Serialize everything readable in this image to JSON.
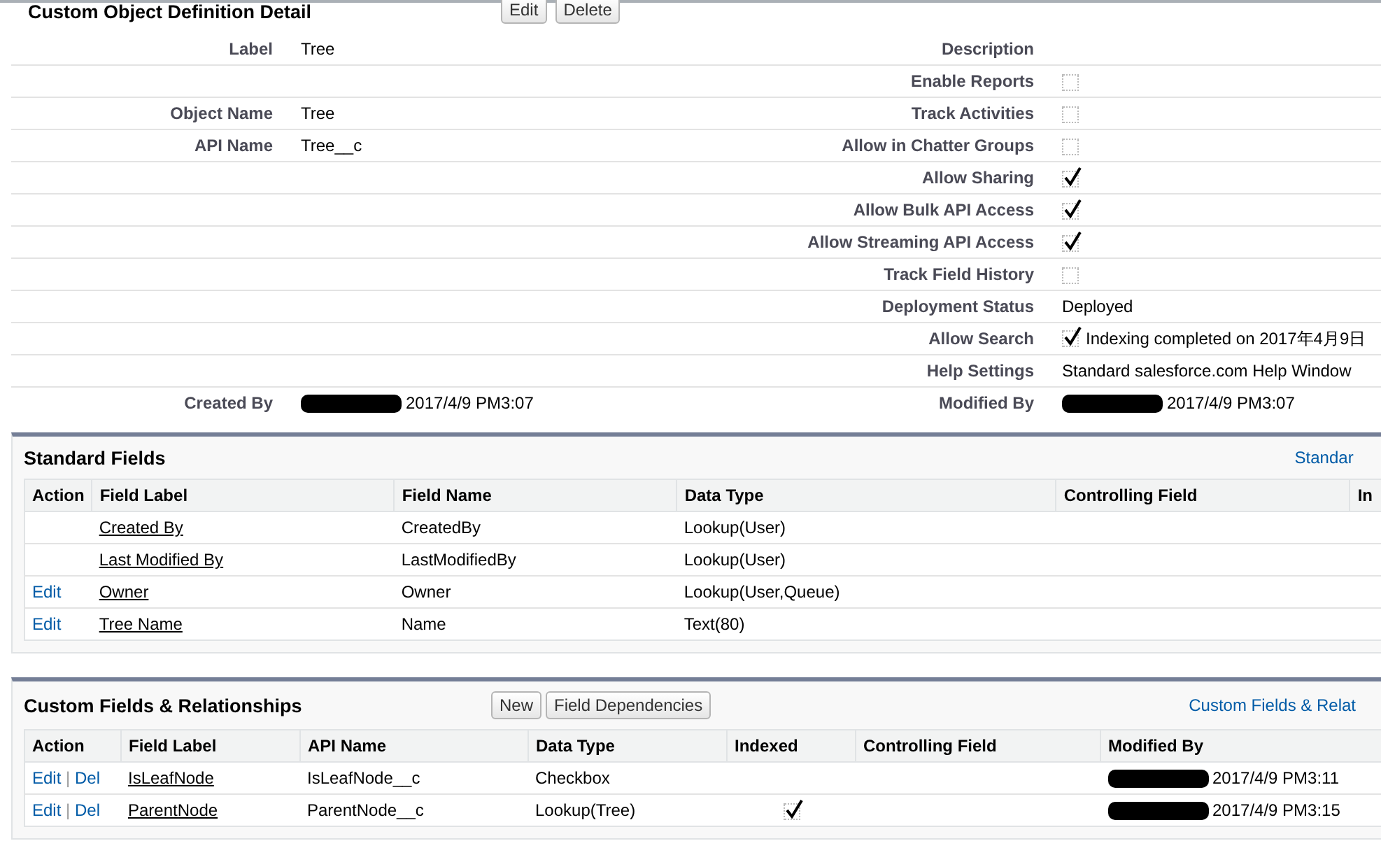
{
  "detail": {
    "title": "Custom Object Definition Detail",
    "buttons": [
      "Edit",
      "Delete"
    ],
    "rows": [
      {
        "left": {
          "label": "Label",
          "value": "Tree"
        },
        "right": {
          "kind": "text",
          "label": "Description"
        }
      },
      {
        "right": {
          "kind": "checkbox",
          "label": "Enable Reports",
          "checked": false
        }
      },
      {
        "left": {
          "label": "Object Name",
          "value": "Tree"
        },
        "right": {
          "kind": "checkbox",
          "label": "Track Activities",
          "checked": false
        }
      },
      {
        "left": {
          "label": "API Name",
          "value": "Tree__c"
        },
        "right": {
          "kind": "checkbox",
          "label": "Allow in Chatter Groups",
          "checked": false
        }
      },
      {
        "right": {
          "kind": "checkbox",
          "label": "Allow Sharing",
          "checked": true
        }
      },
      {
        "right": {
          "kind": "checkbox",
          "label": "Allow Bulk API Access",
          "checked": true
        }
      },
      {
        "right": {
          "kind": "checkbox",
          "label": "Allow Streaming API Access",
          "checked": true
        }
      },
      {
        "right": {
          "kind": "checkbox",
          "label": "Track Field History",
          "checked": false
        }
      },
      {
        "right": {
          "kind": "text",
          "label": "Deployment Status",
          "value": "Deployed"
        }
      },
      {
        "right": {
          "kind": "checkbox",
          "label": "Allow Search",
          "checked": true,
          "note": "Indexing completed on 2017年4月9日"
        }
      },
      {
        "right": {
          "kind": "text",
          "label": "Help Settings",
          "value": "Standard salesforce.com Help Window"
        }
      },
      {
        "left": {
          "label": "Created By",
          "value": "2017/4/9 PM3:07",
          "kind": "user"
        },
        "right": {
          "kind": "user",
          "label": "Modified By",
          "value": "2017/4/9 PM3:07"
        }
      }
    ]
  },
  "standard_fields": {
    "title": "Standard Fields",
    "help_link": "Standar",
    "columns": [
      "Action",
      "Field Label",
      "Field Name",
      "Data Type",
      "Controlling Field",
      "In"
    ],
    "rows": [
      {
        "actions": [],
        "field_label": "Created By",
        "field_name": "CreatedBy",
        "data_type": "Lookup(User)"
      },
      {
        "actions": [],
        "field_label": "Last Modified By",
        "field_name": "LastModifiedBy",
        "data_type": "Lookup(User)"
      },
      {
        "actions": [
          "Edit"
        ],
        "field_label": "Owner",
        "field_name": "Owner",
        "data_type": "Lookup(User,Queue)"
      },
      {
        "actions": [
          "Edit"
        ],
        "field_label": "Tree Name",
        "field_name": "Name",
        "data_type": "Text(80)"
      }
    ]
  },
  "custom_fields": {
    "title": "Custom Fields & Relationships",
    "buttons": [
      "New",
      "Field Dependencies"
    ],
    "action_separator": "|",
    "help_link": "Custom Fields & Relat",
    "columns": [
      "Action",
      "Field Label",
      "API Name",
      "Data Type",
      "Indexed",
      "Controlling Field",
      "Modified By"
    ],
    "rows": [
      {
        "actions": [
          "Edit",
          "Del"
        ],
        "field_label": "IsLeafNode",
        "api_name": "IsLeafNode__c",
        "data_type": "Checkbox",
        "indexed": false,
        "modified_by": "2017/4/9 PM3:11"
      },
      {
        "actions": [
          "Edit",
          "Del"
        ],
        "field_label": "ParentNode",
        "api_name": "ParentNode__c",
        "data_type": "Lookup(Tree)",
        "indexed": true,
        "modified_by": "2017/4/9 PM3:15"
      }
    ]
  }
}
